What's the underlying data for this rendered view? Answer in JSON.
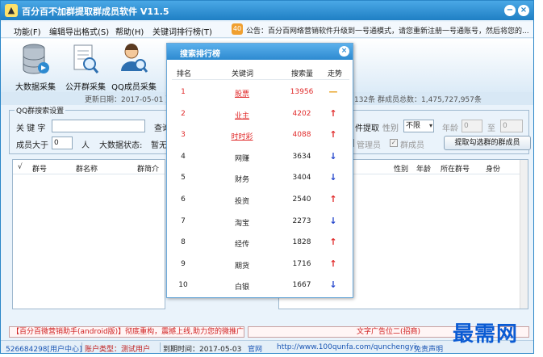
{
  "window": {
    "title": "百分百不加群提取群成员软件 V11.5",
    "min_glyph": "−",
    "close_glyph": "×"
  },
  "menu": {
    "items": [
      "功能(F)",
      "编辑导出格式(S)",
      "帮助(H)",
      "关键词排行榜(T)"
    ],
    "notice_badge": "40",
    "notice": "公告：百分百网络营销软件升级到一号通模式，请您重新注册一号通账号，然后将您的..."
  },
  "toolbar": {
    "tools": [
      {
        "label": "大数据采集",
        "icon": "database-icon"
      },
      {
        "label": "公开群采集",
        "icon": "document-search-icon"
      },
      {
        "label": "QQ成员采集",
        "icon": "user-search-icon"
      }
    ]
  },
  "update": {
    "left": "更新日期：2017-05-01 更新群",
    "right": "132条 群成员总数：1,475,727,957条"
  },
  "settings": {
    "title": "QQ群搜索设置",
    "keyword_label": "关 键 字",
    "keyword_value": "",
    "search_label": "查询",
    "members_label": "成员大于",
    "members_value": "0",
    "members_unit": "人",
    "bigdata_label": "大数据状态:",
    "bigdata_value": "暂无",
    "extract_label": "件提取",
    "gender_label": "性别",
    "gender_value": "不限",
    "age_label": "年龄",
    "age_from": "0",
    "age_to_label": "至",
    "age_to": "0",
    "admin_label": "管理员",
    "member_label": "群成员",
    "extract_button": "提取勾选群的群成员"
  },
  "left_table": {
    "columns": [
      "√",
      "群号",
      "群名称",
      "群简介"
    ]
  },
  "right_table": {
    "columns": [
      "性别",
      "年龄",
      "所在群号",
      "身份"
    ]
  },
  "ranking": {
    "title": "搜索排行榜",
    "columns": {
      "rank": "排名",
      "keyword": "关键词",
      "count": "搜索量",
      "trend": "走势"
    },
    "rows": [
      {
        "rank": "1",
        "keyword": "股票",
        "count": "13956",
        "trend": "flat",
        "glyph": "—",
        "hot": true
      },
      {
        "rank": "2",
        "keyword": "业主",
        "count": "4202",
        "trend": "up",
        "glyph": "↑",
        "hot": true
      },
      {
        "rank": "3",
        "keyword": "时时彩",
        "count": "4088",
        "trend": "up",
        "glyph": "↑",
        "hot": true
      },
      {
        "rank": "4",
        "keyword": "网赚",
        "count": "3634",
        "trend": "down",
        "glyph": "↓",
        "hot": false
      },
      {
        "rank": "5",
        "keyword": "财务",
        "count": "3404",
        "trend": "down",
        "glyph": "↓",
        "hot": false
      },
      {
        "rank": "6",
        "keyword": "投资",
        "count": "2540",
        "trend": "up",
        "glyph": "↑",
        "hot": false
      },
      {
        "rank": "7",
        "keyword": "淘宝",
        "count": "2273",
        "trend": "down",
        "glyph": "↓",
        "hot": false
      },
      {
        "rank": "8",
        "keyword": "经传",
        "count": "1828",
        "trend": "up",
        "glyph": "↑",
        "hot": false
      },
      {
        "rank": "9",
        "keyword": "期货",
        "count": "1716",
        "trend": "up",
        "glyph": "↑",
        "hot": false
      },
      {
        "rank": "10",
        "keyword": "白银",
        "count": "1667",
        "trend": "down",
        "glyph": "↓",
        "hot": false
      }
    ]
  },
  "ads": {
    "ad1": "【百分百微营销助手(android版)】彻底重构，震撼上线,助力您的微推广",
    "ad2": "文字广告位二(招商)"
  },
  "status": {
    "user": "526684298[用户中心]",
    "type": "账户类型：测试用户",
    "expire": "到期时间：2017-05-03",
    "site_label": "官网",
    "site": "http://www.100qunfa.com/qunchengyi",
    "disclaimer": "免责声明"
  },
  "watermark": "最需网"
}
